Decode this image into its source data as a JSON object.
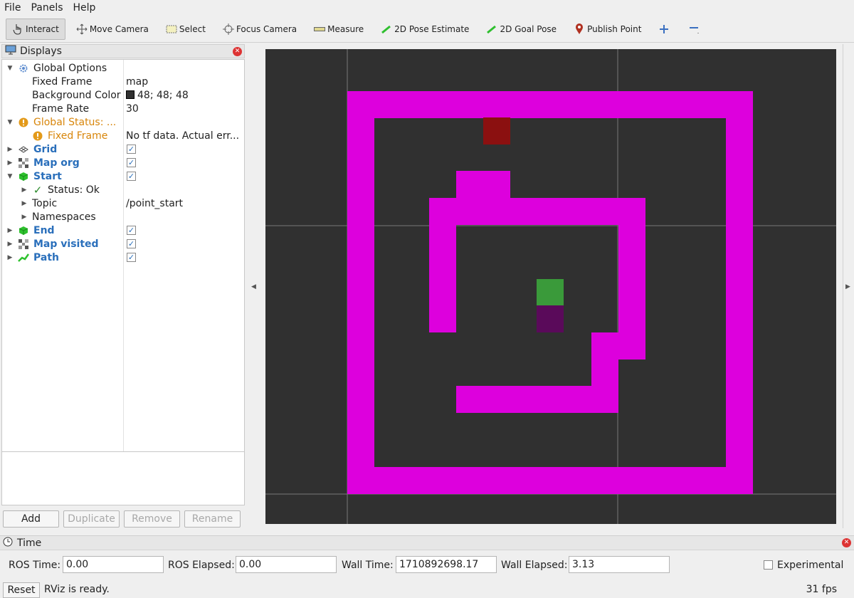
{
  "menu": [
    "File",
    "Panels",
    "Help"
  ],
  "toolbar": {
    "interact": "Interact",
    "move_camera": "Move Camera",
    "select": "Select",
    "focus_camera": "Focus Camera",
    "measure": "Measure",
    "pose_estimate": "2D Pose Estimate",
    "goal_pose": "2D Goal Pose",
    "publish_point": "Publish Point"
  },
  "displays": {
    "title": "Displays",
    "global_options": "Global Options",
    "fixed_frame_label": "Fixed Frame",
    "fixed_frame_value": "map",
    "bg_color_label": "Background Color",
    "bg_color_value": "48; 48; 48",
    "bg_color_hex": "#303030",
    "frame_rate_label": "Frame Rate",
    "frame_rate_value": "30",
    "global_status": "Global Status: ...",
    "fixed_frame_status_label": "Fixed Frame",
    "fixed_frame_status_value": "No tf data.  Actual err...",
    "grid": "Grid",
    "map_org": "Map org",
    "start": "Start",
    "status_ok": "Status: Ok",
    "topic_label": "Topic",
    "topic_value": "/point_start",
    "namespaces": "Namespaces",
    "end": "End",
    "map_visited": "Map visited",
    "path": "Path"
  },
  "buttons": {
    "add": "Add",
    "duplicate": "Duplicate",
    "remove": "Remove",
    "rename": "Rename"
  },
  "time": {
    "title": "Time",
    "ros_time_label": "ROS Time:",
    "ros_time_value": "0.00",
    "ros_elapsed_label": "ROS Elapsed:",
    "ros_elapsed_value": "0.00",
    "wall_time_label": "Wall Time:",
    "wall_time_value": "1710892698.17",
    "wall_elapsed_label": "Wall Elapsed:",
    "wall_elapsed_value": "3.13",
    "experimental": "Experimental"
  },
  "status": {
    "reset": "Reset",
    "message": "RViz is ready.",
    "fps": "31 fps"
  },
  "colors": {
    "path": "#dd00dd",
    "start": "#3a9a3a",
    "end": "#5a0a5a",
    "visited": "#8b1010",
    "grid_line": "#7a7a7a"
  }
}
